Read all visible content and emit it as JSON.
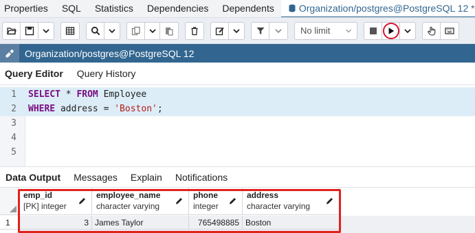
{
  "tabs": [
    {
      "label": "Properties"
    },
    {
      "label": "SQL"
    },
    {
      "label": "Statistics"
    },
    {
      "label": "Dependencies"
    },
    {
      "label": "Dependents"
    },
    {
      "label": "Organization/postgres@PostgreSQL 12 *",
      "active": true
    }
  ],
  "toolbar": {
    "limit_label": "No limit"
  },
  "connection": {
    "title": "Organization/postgres@PostgreSQL 12"
  },
  "editor_tabs": [
    {
      "label": "Query Editor",
      "active": true
    },
    {
      "label": "Query History"
    }
  ],
  "editor": {
    "line_numbers": [
      "1",
      "2",
      "3",
      "4",
      "5"
    ],
    "line1": {
      "kw1": "SELECT",
      "mid": " * ",
      "kw2": "FROM",
      "rest": " Employee"
    },
    "line2": {
      "kw1": "WHERE",
      "mid": " address = ",
      "str": "'Boston'",
      "rest": ";"
    }
  },
  "output_tabs": [
    {
      "label": "Data Output",
      "active": true
    },
    {
      "label": "Messages"
    },
    {
      "label": "Explain"
    },
    {
      "label": "Notifications"
    }
  ],
  "grid": {
    "columns": [
      {
        "name": "emp_id",
        "type": "[PK] integer"
      },
      {
        "name": "employee_name",
        "type": "character varying"
      },
      {
        "name": "phone",
        "type": "integer"
      },
      {
        "name": "address",
        "type": "character varying"
      }
    ],
    "rows": [
      {
        "num": "1",
        "cells": [
          "3",
          "James Taylor",
          "765498885",
          "Boston"
        ]
      }
    ]
  },
  "colors": {
    "accent": "#326690",
    "highlight_box": "#e0211c",
    "keyword": "#7a0e82",
    "string": "#b51a1a"
  }
}
